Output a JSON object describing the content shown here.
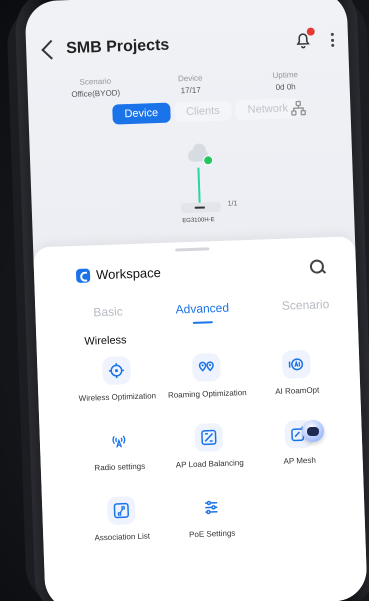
{
  "header": {
    "title": "SMB Projects"
  },
  "stats": [
    {
      "label": "Scenario",
      "value": "Office(BYOD)"
    },
    {
      "label": "Device",
      "value": "17/17"
    },
    {
      "label": "Uptime",
      "value": "0d 0h"
    }
  ],
  "view_tabs": [
    "Device",
    "Clients",
    "Network"
  ],
  "topology": {
    "port_count": "1/1",
    "device_name": "EG3100H-E"
  },
  "workspace": {
    "title": "Workspace",
    "tabs": [
      "Basic",
      "Advanced",
      "Scenario"
    ],
    "section_title": "Wireless",
    "items": [
      {
        "label": "Wireless Optimization",
        "icon": "wireless-optimization-icon"
      },
      {
        "label": "Roaming Optimization",
        "icon": "roaming-optimization-icon"
      },
      {
        "label": "AI RoamOpt",
        "icon": "ai-roamopt-icon"
      },
      {
        "label": "Radio settings",
        "icon": "radio-settings-icon"
      },
      {
        "label": "AP Load Balancing",
        "icon": "ap-load-balancing-icon"
      },
      {
        "label": "AP Mesh",
        "icon": "ap-mesh-icon"
      },
      {
        "label": "Association List",
        "icon": "association-list-icon"
      },
      {
        "label": "PoE Settings",
        "icon": "poe-settings-icon"
      }
    ]
  },
  "colors": {
    "accent": "#1a73e8",
    "online": "#22c55e",
    "badge": "#e53935"
  }
}
